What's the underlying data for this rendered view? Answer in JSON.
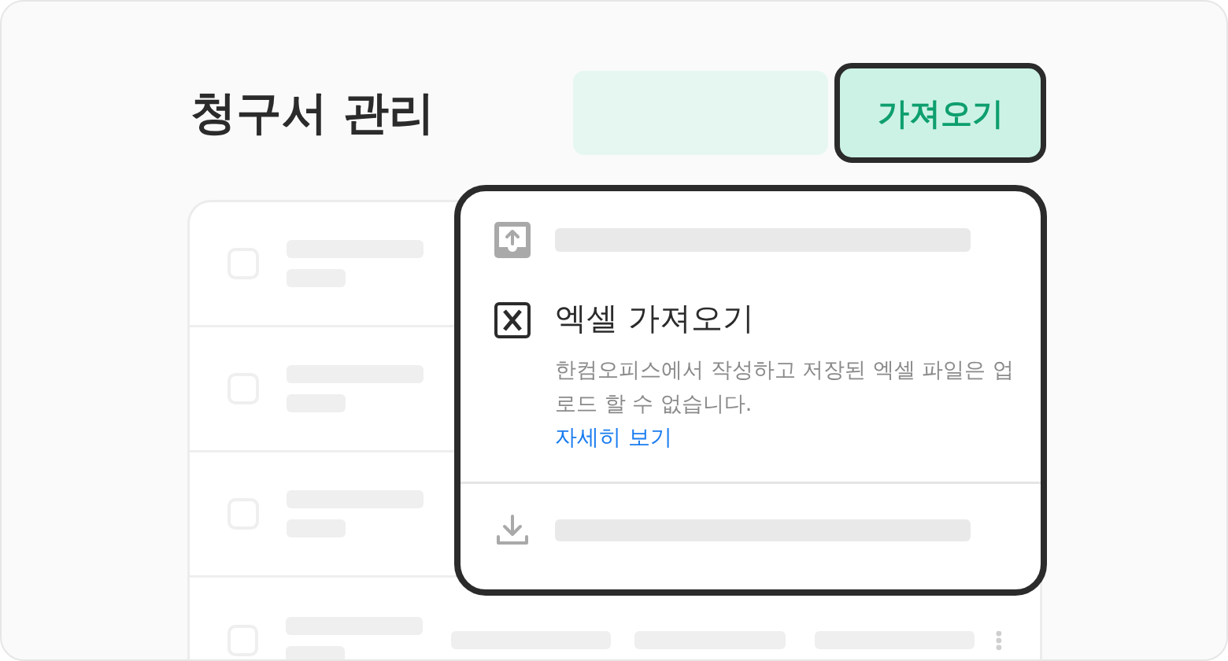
{
  "title": "청구서 관리",
  "import_button": {
    "label": "가져오기"
  },
  "rows": [
    {
      "checked": false
    },
    {
      "checked": false
    },
    {
      "checked": false
    },
    {
      "checked": false
    }
  ],
  "import_menu": {
    "items": [
      {
        "kind": "upload"
      },
      {
        "kind": "excel",
        "title": "엑셀 가져오기",
        "description": "한컴오피스에서 작성하고 저장된 엑셀 파일은 업로드 할 수 없습니다.",
        "link": "자세히 보기"
      },
      {
        "kind": "download"
      }
    ]
  }
}
